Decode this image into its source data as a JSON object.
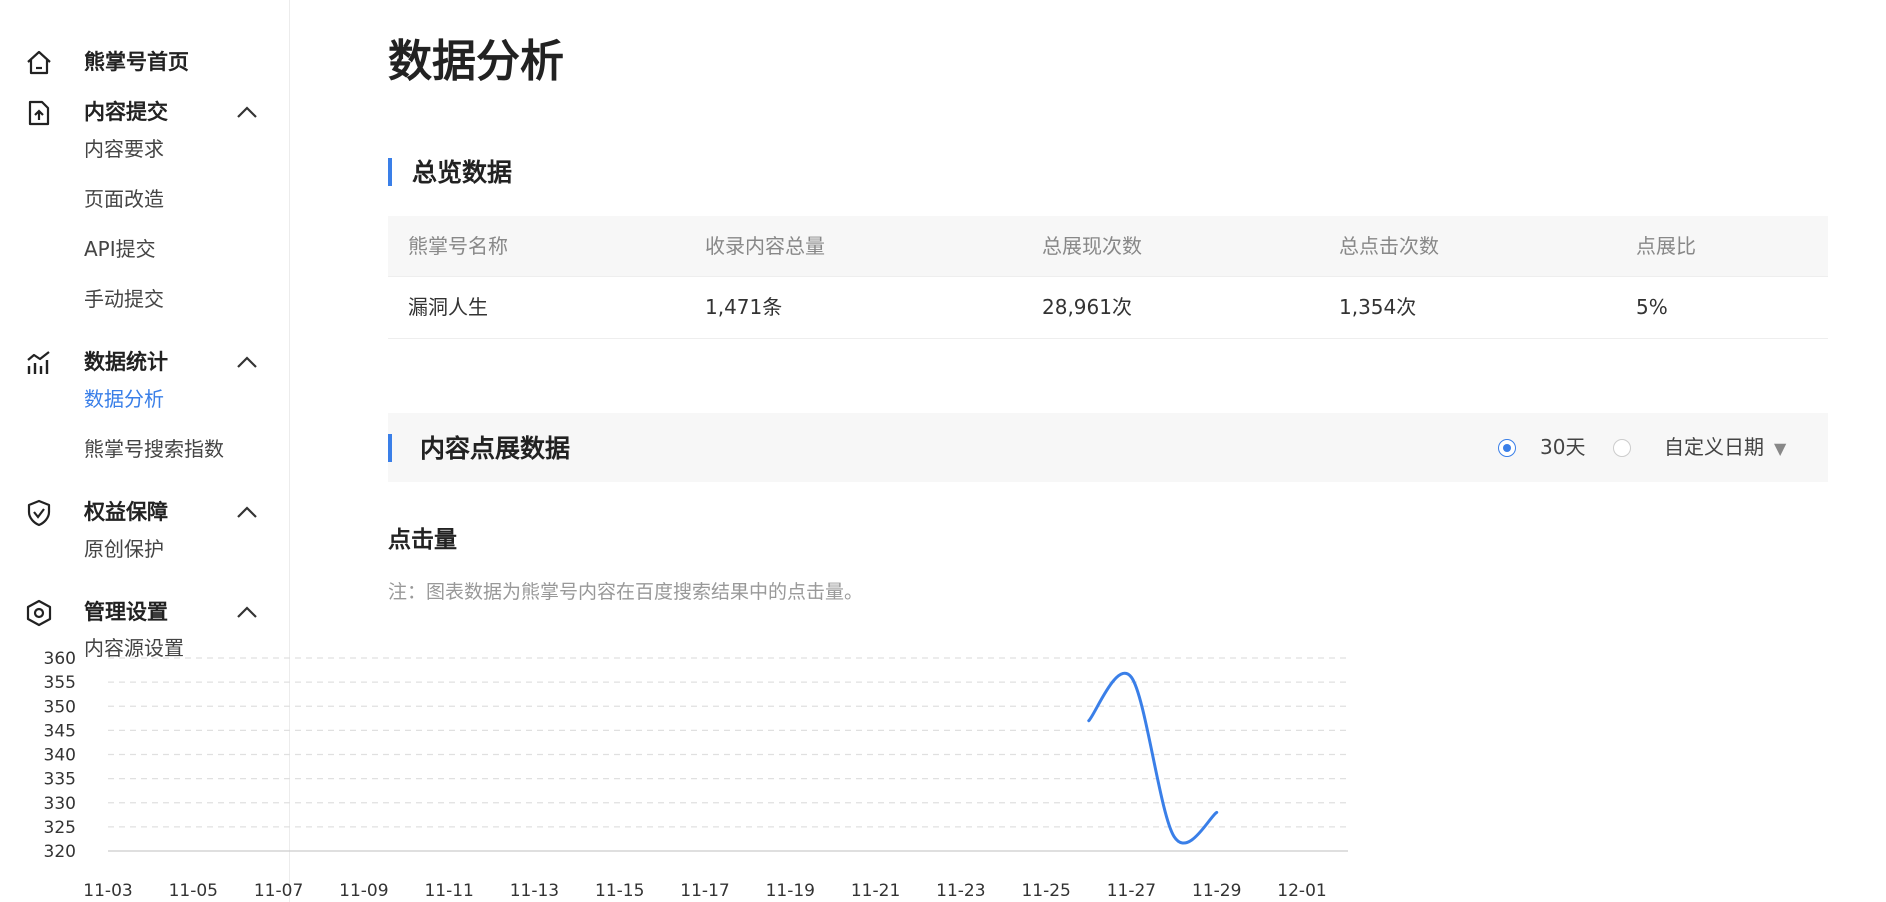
{
  "sidebar": {
    "groups": [
      {
        "label": "熊掌号首页",
        "icon": "home-icon",
        "expandable": false,
        "items": []
      },
      {
        "label": "内容提交",
        "icon": "upload-doc-icon",
        "expandable": true,
        "items": [
          {
            "label": "内容要求"
          },
          {
            "label": "页面改造"
          },
          {
            "label": "API提交"
          },
          {
            "label": "手动提交"
          }
        ]
      },
      {
        "label": "数据统计",
        "icon": "chart-icon",
        "expandable": true,
        "items": [
          {
            "label": "数据分析",
            "active": true
          },
          {
            "label": "熊掌号搜索指数"
          }
        ]
      },
      {
        "label": "权益保障",
        "icon": "shield-icon",
        "expandable": true,
        "items": [
          {
            "label": "原创保护"
          }
        ]
      },
      {
        "label": "管理设置",
        "icon": "settings-icon",
        "expandable": true,
        "items": [
          {
            "label": "内容源设置"
          }
        ]
      }
    ]
  },
  "main": {
    "title": "数据分析",
    "overview": {
      "title": "总览数据",
      "headers": [
        "熊掌号名称",
        "收录内容总量",
        "总展现次数",
        "总点击次数",
        "点展比"
      ],
      "row": [
        "漏洞人生",
        "1,471条",
        "28,961次",
        "1,354次",
        "5%"
      ]
    },
    "content": {
      "title": "内容点展数据",
      "range_options": [
        {
          "label": "30天",
          "checked": true
        },
        {
          "label": "",
          "checked": false
        }
      ],
      "custom_date_label": "自定义日期"
    },
    "chart_heading": "点击量",
    "chart_note": "注：图表数据为熊掌号内容在百度搜索结果中的点击量。"
  },
  "colors": {
    "accent": "#3a7fe8",
    "grid": "#e0e0e0"
  },
  "chart_data": {
    "type": "line",
    "title": "",
    "xlabel": "",
    "ylabel": "",
    "ylim": [
      320,
      360
    ],
    "yticks": [
      360,
      355,
      350,
      345,
      340,
      335,
      330,
      325,
      320
    ],
    "xticks": [
      "11-03",
      "11-05",
      "11-07",
      "11-09",
      "11-11",
      "11-13",
      "11-15",
      "11-17",
      "11-19",
      "11-21",
      "11-23",
      "11-25",
      "11-27",
      "11-29",
      "12-01"
    ],
    "x_axis_start": "11-03",
    "x_axis_end": "12-01",
    "grid": true,
    "series": [
      {
        "x": [
          "11-26",
          "11-27",
          "11-28",
          "11-29"
        ],
        "values": [
          347,
          356,
          323,
          328
        ]
      }
    ]
  }
}
